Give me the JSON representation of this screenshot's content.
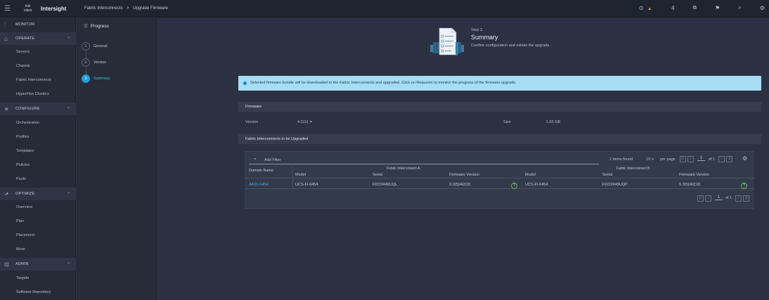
{
  "topbar": {
    "logo_line1": "ılıılı",
    "logo_line2": "cisco",
    "app_name": "Intersight",
    "breadcrumb_parent": "Fabric Interconnects",
    "breadcrumb_sep": ">",
    "breadcrumb_current": "Upgrade Firmware",
    "alert_count": "4"
  },
  "sidebar": {
    "monitor": "MONITOR",
    "operate": "OPERATE",
    "operate_items": [
      "Servers",
      "Chassis",
      "Fabric Interconnects",
      "HyperFlex Clusters"
    ],
    "configure": "CONFIGURE",
    "configure_items": [
      "Orchestration",
      "Profiles",
      "Templates",
      "Policies",
      "Pools"
    ],
    "optimize": "OPTIMIZE",
    "optimize_items": [
      "Overview",
      "Plan",
      "Placement",
      "More"
    ],
    "admin": "ADMIN",
    "admin_items": [
      "Targets",
      "Software Repository"
    ]
  },
  "progress": {
    "title": "Progress",
    "steps": [
      {
        "num": "1",
        "label": "General"
      },
      {
        "num": "2",
        "label": "Version"
      },
      {
        "num": "3",
        "label": "Summary"
      }
    ]
  },
  "summary": {
    "step_no": "Step 3",
    "title": "Summary",
    "subtitle": "Confirm configuration and initiate the upgrade."
  },
  "banner": {
    "text": "Selected firmware bundle will be downloaded to the Fabric Interconnects and upgraded. Click on Requests to monitor the progress of the firmware upgrade."
  },
  "firmware": {
    "header": "Firmware",
    "version_label": "Version",
    "version_value": "4.2(1i) ⚭",
    "size_label": "Size",
    "size_value": "1.65 GB"
  },
  "fi_section": {
    "header": "Fabric Interconnects to be Upgraded",
    "filter_placeholder": "Add Filter",
    "items_found": "1 items found",
    "per_page_value": "10",
    "per_page_label": "per page",
    "page": "1",
    "of_pages": "of 1",
    "group_a": "Fabric Interconnect A",
    "group_b": "Fabric Interconnect B",
    "col_domain": "Domain Name",
    "col_model": "Model",
    "col_serial": "Serial",
    "col_fw": "Firmware Version",
    "row": {
      "domain": "AA16-6454",
      "a_model": "UCS-FI-6454",
      "a_serial": "FDO2449UQL",
      "a_fw": "9.3(5)I42(1f)",
      "b_model": "UCS-FI-6454",
      "b_serial": "FDO2449UQP",
      "b_fw": "9.3(5)I42(1f)"
    }
  }
}
